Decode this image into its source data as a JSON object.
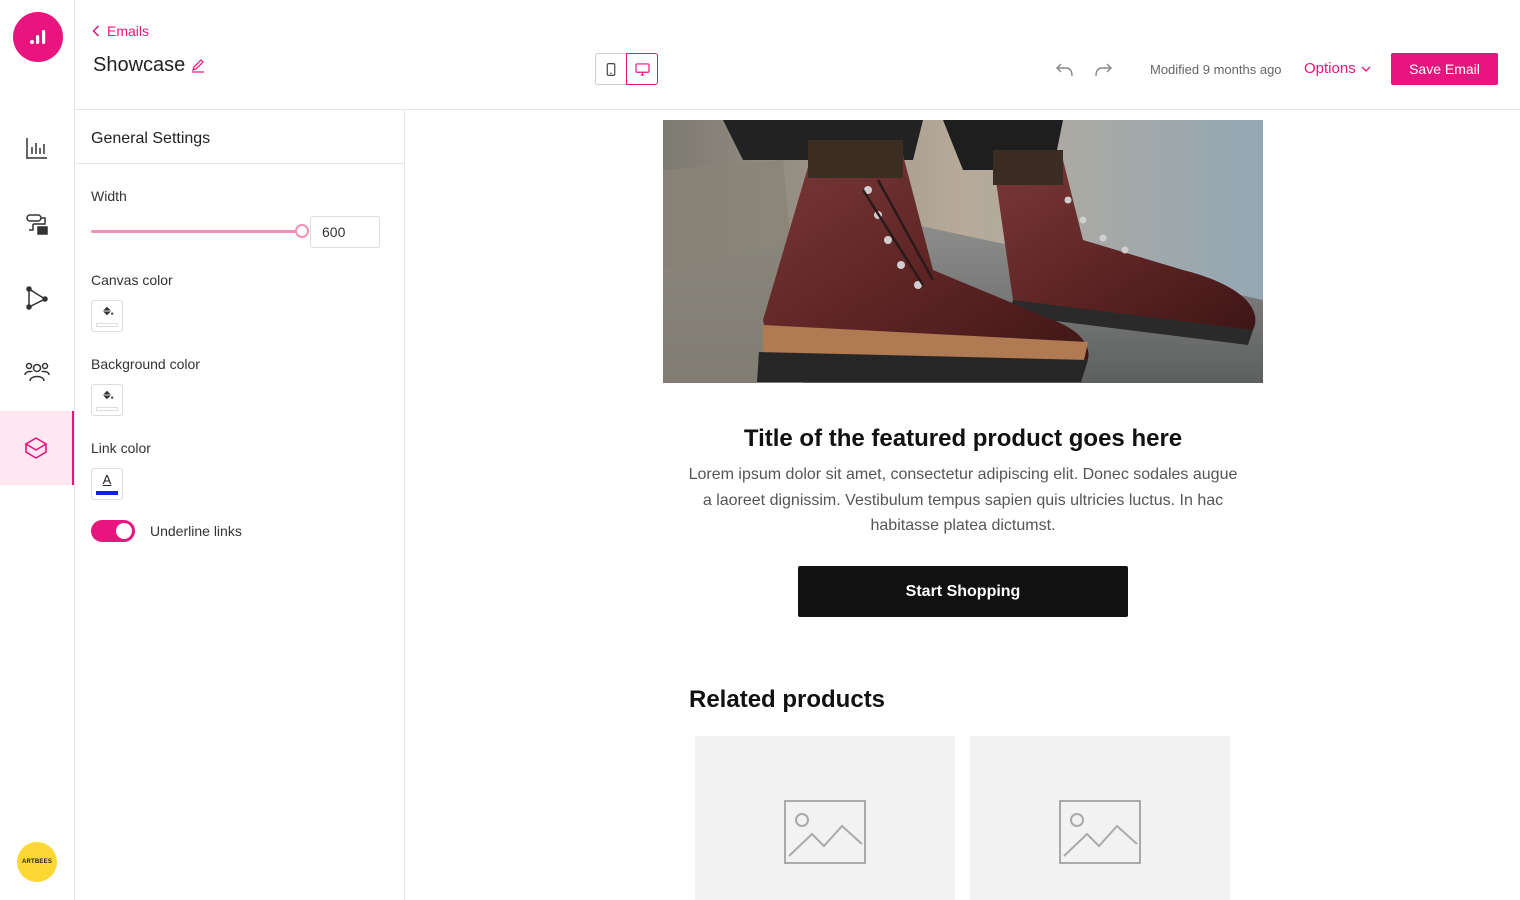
{
  "colors": {
    "accent": "#e8157e",
    "brand_badge": "#fdd835",
    "cta": "#111111",
    "link_swatch": "#1020e0"
  },
  "rail": {
    "items": [
      {
        "icon": "analytics-icon"
      },
      {
        "icon": "workflow-icon"
      },
      {
        "icon": "funnel-flow-icon"
      },
      {
        "icon": "audience-icon"
      },
      {
        "icon": "email-box-icon",
        "active": true
      }
    ],
    "brand_label": "ARTBEES"
  },
  "header": {
    "back_label": "Emails",
    "title": "Showcase",
    "modified": "Modified 9 months ago",
    "options_label": "Options",
    "save_label": "Save Email"
  },
  "settings": {
    "heading": "General Settings",
    "width_label": "Width",
    "width_value": "600",
    "width_slider_fraction": 1.0,
    "canvas_color_label": "Canvas color",
    "background_color_label": "Background color",
    "link_color_label": "Link color",
    "link_swatch_glyph": "A",
    "underline_label": "Underline links",
    "underline_on": true
  },
  "email": {
    "hero_alt": "",
    "product_title": "Title of the featured product goes here",
    "product_desc": "Lorem ipsum dolor sit amet, consectetur adipiscing elit. Donec sodales augue a laoreet dignissim. Vestibulum tempus sapien quis ultricies luctus. In hac habitasse platea dictumst.",
    "cta_label": "Start Shopping",
    "related_title": "Related products"
  }
}
